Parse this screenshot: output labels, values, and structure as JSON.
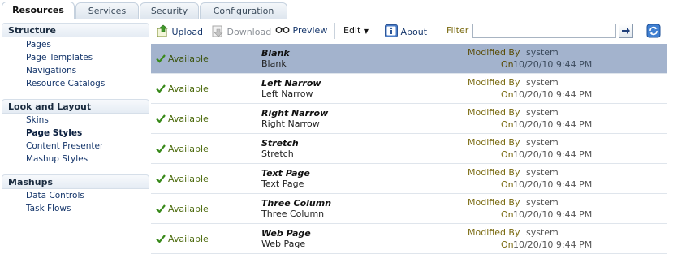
{
  "tabs": [
    {
      "label": "Resources",
      "active": true
    },
    {
      "label": "Services",
      "active": false
    },
    {
      "label": "Security",
      "active": false
    },
    {
      "label": "Configuration",
      "active": false
    }
  ],
  "sidebar": {
    "sections": [
      {
        "title": "Structure",
        "items": [
          "Pages",
          "Page Templates",
          "Navigations",
          "Resource Catalogs"
        ]
      },
      {
        "title": "Look and Layout",
        "items": [
          "Skins",
          "Page Styles",
          "Content Presenter",
          "Mashup Styles"
        ]
      },
      {
        "title": "Mashups",
        "items": [
          "Data Controls",
          "Task Flows"
        ]
      }
    ],
    "selected_item": "Page Styles"
  },
  "toolbar": {
    "upload": "Upload",
    "download": "Download",
    "preview": "Preview",
    "edit": "Edit",
    "about": "About",
    "filter_label": "Filter",
    "filter_value": ""
  },
  "rows": [
    {
      "status": "Available",
      "title": "Blank",
      "name": "Blank",
      "modified_label": "Modified By",
      "modified_by": "system",
      "on_label": "On",
      "date": "10/20/10 9:44 PM",
      "selected": true
    },
    {
      "status": "Available",
      "title": "Left Narrow",
      "name": "Left Narrow",
      "modified_label": "Modified By",
      "modified_by": "system",
      "on_label": "On",
      "date": "10/20/10 9:44 PM",
      "selected": false
    },
    {
      "status": "Available",
      "title": "Right Narrow",
      "name": "Right Narrow",
      "modified_label": "Modified By",
      "modified_by": "system",
      "on_label": "On",
      "date": "10/20/10 9:44 PM",
      "selected": false
    },
    {
      "status": "Available",
      "title": "Stretch",
      "name": "Stretch",
      "modified_label": "Modified By",
      "modified_by": "system",
      "on_label": "On",
      "date": "10/20/10 9:44 PM",
      "selected": false
    },
    {
      "status": "Available",
      "title": "Text Page",
      "name": "Text Page",
      "modified_label": "Modified By",
      "modified_by": "system",
      "on_label": "On",
      "date": "10/20/10 9:44 PM",
      "selected": false
    },
    {
      "status": "Available",
      "title": "Three Column",
      "name": "Three Column",
      "modified_label": "Modified By",
      "modified_by": "system",
      "on_label": "On",
      "date": "10/20/10 9:44 PM",
      "selected": false
    },
    {
      "status": "Available",
      "title": "Web Page",
      "name": "Web Page",
      "modified_label": "Modified By",
      "modified_by": "system",
      "on_label": "On",
      "date": "10/20/10 9:44 PM",
      "selected": false
    }
  ],
  "colors": {
    "selected_row": "#a3b3cd",
    "accent_text": "#7a6a10",
    "link": "#15366b",
    "available": "#4c6a0c"
  }
}
